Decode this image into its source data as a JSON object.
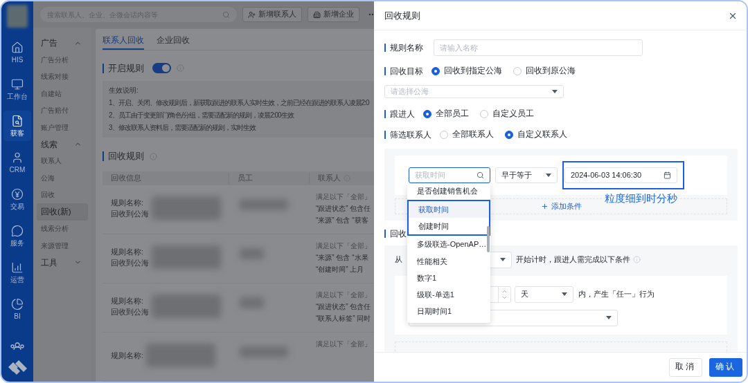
{
  "sidebar": {
    "items": [
      {
        "kind": "home",
        "label": "HIS",
        "selected": false
      },
      {
        "kind": "desk",
        "label": "工作台",
        "selected": false
      },
      {
        "kind": "leads",
        "label": "获客",
        "selected": true
      },
      {
        "kind": "crm",
        "label": "CRM",
        "selected": false
      },
      {
        "kind": "trade",
        "label": "交易",
        "selected": false
      },
      {
        "kind": "service",
        "label": "服务",
        "selected": false
      },
      {
        "kind": "ops",
        "label": "运营",
        "selected": false
      },
      {
        "kind": "bi",
        "label": "BI",
        "selected": false
      }
    ]
  },
  "topbar": {
    "search_placeholder": "搜索联系人、企业、企微会话内容等",
    "buttons": [
      {
        "kind": "contact",
        "label": "新增联系人"
      },
      {
        "kind": "company",
        "label": "新增企业"
      }
    ]
  },
  "nav": {
    "groups": [
      {
        "label": "广告",
        "expanded": true,
        "children": [
          {
            "label": "广告分析",
            "selected": false
          },
          {
            "label": "线索对接",
            "selected": false
          },
          {
            "label": "自建站",
            "selected": false
          },
          {
            "label": "广告赔付",
            "selected": false
          },
          {
            "label": "账户管理",
            "selected": false
          }
        ]
      },
      {
        "label": "线索",
        "expanded": true,
        "children": [
          {
            "label": "联系人",
            "selected": false
          },
          {
            "label": "公海",
            "selected": false
          },
          {
            "label": "回收",
            "selected": false
          },
          {
            "label": "回收(新)",
            "selected": true
          },
          {
            "label": "线索分析",
            "selected": false
          },
          {
            "label": "来源管理",
            "selected": false
          }
        ]
      },
      {
        "label": "工具",
        "expanded": false
      }
    ]
  },
  "tabs": [
    {
      "label": "联系人回收",
      "selected": true
    },
    {
      "label": "企业回收",
      "selected": false
    }
  ],
  "rule_switch": {
    "label": "开启规则",
    "on": true
  },
  "notice": {
    "title": "生效说明:",
    "lines": [
      "1、开启、关闭、修改规则后，新获取跟进的联系人实时生效，之前已经在跟进的联系人凌晨2:0",
      "2、员工由于变更部门/角色/分组，需要适配新的规则，凌晨2:00生效",
      "3、修改联系人资料后，需要适配新的规则，实时生效"
    ]
  },
  "rules": {
    "title": "回收规则",
    "columns": [
      "回收信息",
      "员工",
      "联系人"
    ],
    "rows": [
      {
        "info": [
          "规则名称:",
          "回收到公海"
        ],
        "conditions": [
          "满足以下「全部」",
          "“跟进状态” 包含任",
          "“来源” 包含 “获客"
        ]
      },
      {
        "info": [
          "规则名称:",
          "回收到公海"
        ],
        "conditions": [
          "满足以下「全部」",
          "“来源” 包含 “水果",
          "“创建时间” 上月"
        ]
      },
      {
        "info": [
          "规则名称:",
          "回收到公海"
        ],
        "conditions": [
          "满足以下「全部」",
          "“跟进状态” 包含任",
          "“联系人标签” 同时"
        ]
      },
      {
        "info": [
          "规则名称:"
        ],
        "conditions": [
          "满足以下「全部」"
        ]
      }
    ]
  },
  "drawer": {
    "title": "回收规则",
    "rule_name": {
      "label": "规则名称",
      "placeholder": "请输入名称"
    },
    "target": {
      "label": "回收目标",
      "options": [
        {
          "label": "回收到指定公海",
          "selected": true
        },
        {
          "label": "回收到原公海",
          "selected": false
        }
      ],
      "select_placeholder": "请选择公海"
    },
    "follower": {
      "label": "跟进人",
      "options": [
        {
          "label": "全部员工",
          "selected": true
        },
        {
          "label": "自定义员工",
          "selected": false
        }
      ]
    },
    "contact_filter": {
      "label": "筛选联系人",
      "options": [
        {
          "label": "全部联系人",
          "selected": false
        },
        {
          "label": "自定义联系人",
          "selected": true
        }
      ]
    },
    "condition": {
      "field_placeholder": "获取时间",
      "operator": "早于等于",
      "date": {
        "value": "2024-06-03 14:06:30",
        "highlighted": true
      },
      "add_label": "添加条件",
      "note": "粒度细到时分秒",
      "dropdown": [
        {
          "label": "是否创建销售机会",
          "selected": false,
          "highlighted": false
        },
        {
          "label": "获取时间",
          "selected": true,
          "highlighted": true
        },
        {
          "label": "创建时间",
          "selected": false,
          "highlighted": true
        },
        {
          "label": "多级联选-OpenAP…",
          "selected": false,
          "highlighted": false
        },
        {
          "label": "性能相关",
          "selected": false,
          "highlighted": false
        },
        {
          "label": "数字1",
          "selected": false,
          "highlighted": false
        },
        {
          "label": "级联-单选1",
          "selected": false,
          "highlighted": false
        },
        {
          "label": "日期时间1",
          "selected": false,
          "highlighted": false
        }
      ]
    },
    "recycle": {
      "label": "回收",
      "from_label": "从",
      "timing_text": "开始计时，跟进人需完成以下条件",
      "unit": "天",
      "behavior_text": "内，产生「任一」行为"
    },
    "buttons": [
      {
        "kind": "secondary",
        "label": "取消"
      },
      {
        "kind": "primary",
        "label": "确认"
      }
    ]
  }
}
